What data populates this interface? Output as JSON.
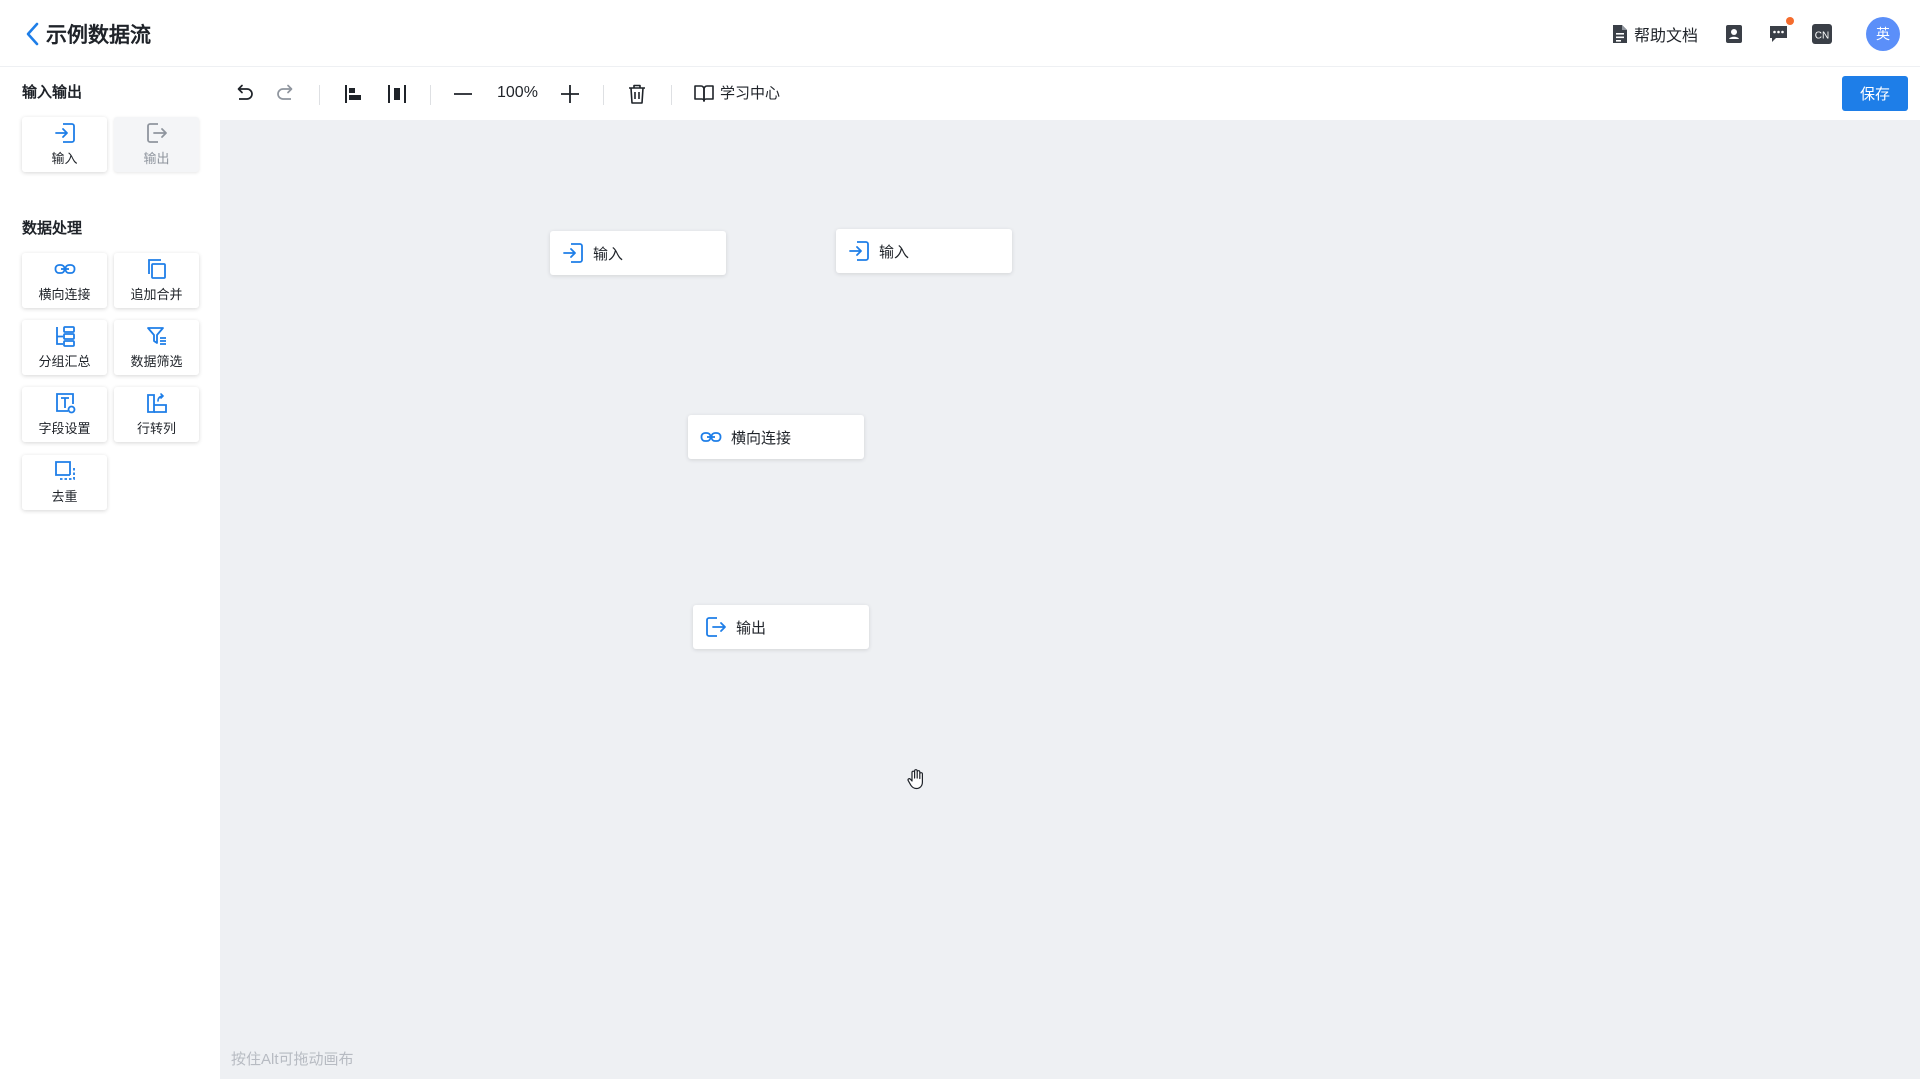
{
  "header": {
    "title": "示例数据流",
    "help_label": "帮助文档",
    "avatar_text": "英",
    "lang_icon_text": "CN"
  },
  "sidebar": {
    "section_io": "输入输出",
    "io_tools": [
      {
        "label": "输入",
        "icon": "input-icon",
        "disabled": false
      },
      {
        "label": "输出",
        "icon": "output-icon",
        "disabled": true
      }
    ],
    "section_process": "数据处理",
    "process_tools": [
      {
        "label": "横向连接",
        "icon": "link-icon"
      },
      {
        "label": "追加合并",
        "icon": "copy-merge-icon"
      },
      {
        "label": "分组汇总",
        "icon": "group-summary-icon"
      },
      {
        "label": "数据筛选",
        "icon": "filter-icon"
      },
      {
        "label": "字段设置",
        "icon": "field-settings-icon"
      },
      {
        "label": "行转列",
        "icon": "row-to-column-icon"
      },
      {
        "label": "去重",
        "icon": "dedupe-icon"
      }
    ]
  },
  "toolbar": {
    "zoom": "100%",
    "learn_label": "学习中心",
    "save_label": "保存"
  },
  "canvas": {
    "nodes": [
      {
        "label": "输入",
        "icon": "input-icon"
      },
      {
        "label": "输入",
        "icon": "input-icon"
      },
      {
        "label": "横向连接",
        "icon": "link-icon"
      },
      {
        "label": "输出",
        "icon": "output-icon"
      }
    ],
    "hint": "按住Alt可拖动画布"
  },
  "colors": {
    "accent": "#1e7ee8",
    "canvas_bg": "#eef0f3",
    "notification_dot": "#f56c2d",
    "avatar_bg": "#5b8ff9"
  }
}
